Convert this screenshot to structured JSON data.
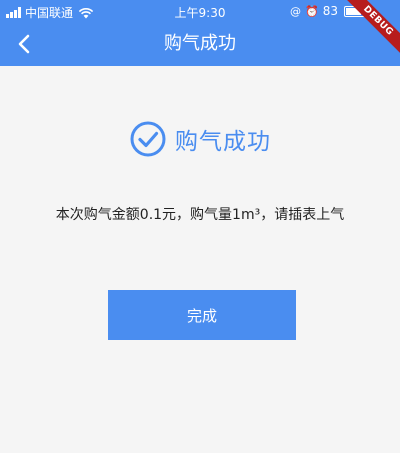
{
  "status_bar": {
    "carrier": "中国联通",
    "time": "上午9:30",
    "battery_text": "83",
    "battery_level": 0.83
  },
  "debug_banner": "DEBUG",
  "nav": {
    "title": "购气成功"
  },
  "result": {
    "title": "购气成功",
    "message": "本次购气金额0.1元，购气量1m³，请插表上气"
  },
  "done_button": {
    "label": "完成"
  },
  "colors": {
    "primary": "#4a8df0",
    "background": "#f5f5f5"
  }
}
